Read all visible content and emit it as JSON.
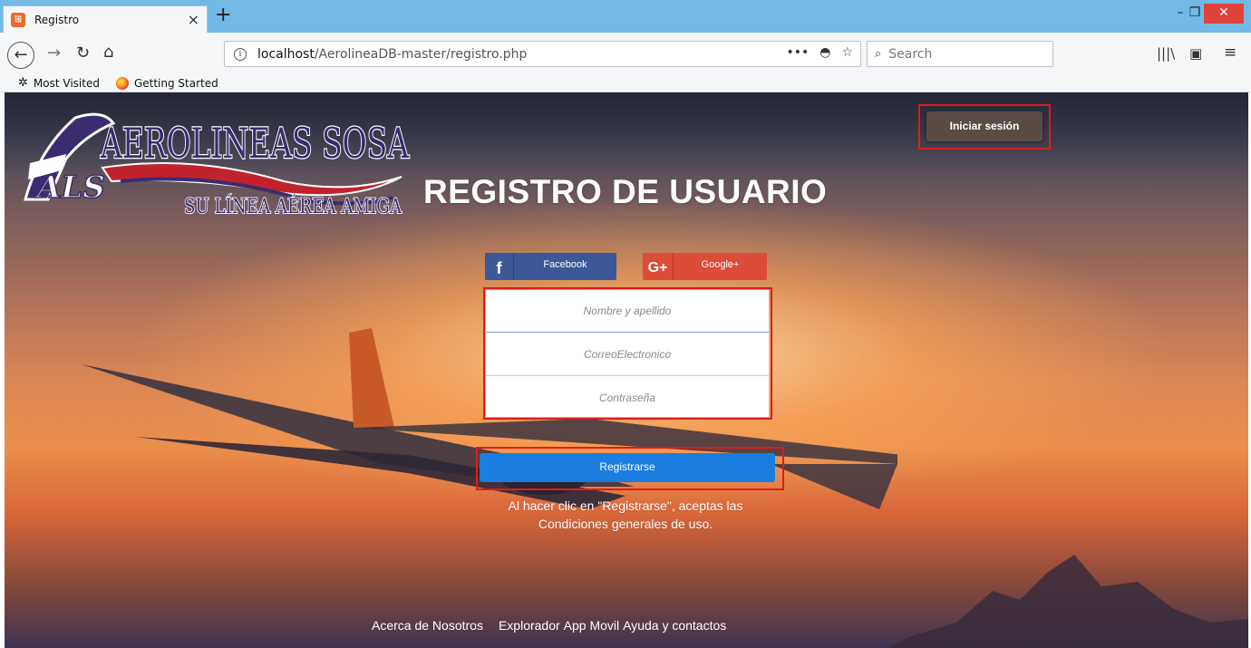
{
  "browser": {
    "tab_title": "Registro",
    "tab_close": "×",
    "new_tab": "+",
    "url_host": "localhost",
    "url_path": "/AerolineaDB-master/registro.php",
    "url_more": "•••",
    "search_placeholder": "Search",
    "window_min": "–",
    "window_max": "❐",
    "window_close": "✕",
    "bookmarks": [
      "Most Visited",
      "Getting Started"
    ]
  },
  "logo": {
    "brand_name": "AEROLINEAS SOSA",
    "tagline": "SU LÍNEA AÉREA AMIGA",
    "monogram": "ALS"
  },
  "header": {
    "title": "REGISTRO DE USUARIO",
    "login_button": "Iniciar sesión"
  },
  "social": {
    "facebook_label": "Facebook",
    "facebook_icon": "f",
    "google_label": "Google+",
    "google_icon": "G+"
  },
  "form": {
    "name_placeholder": "Nombre y apellido",
    "email_placeholder": "CorreoElectronico",
    "password_placeholder": "Contraseña",
    "submit_label": "Registrarse"
  },
  "terms": {
    "line1": "Al hacer clic en \"Registrarse\", aceptas las",
    "line2": "Condiciones generales de uso."
  },
  "footer": {
    "links": [
      "Acerca de Nosotros",
      "Explorador",
      "App Movil",
      "Ayuda y contactos"
    ]
  },
  "colors": {
    "login_button": "#5a4b45",
    "facebook": "#3b5998",
    "google": "#dd4b39",
    "register_button": "#1a7de0",
    "highlight_box": "#e01b1b"
  }
}
